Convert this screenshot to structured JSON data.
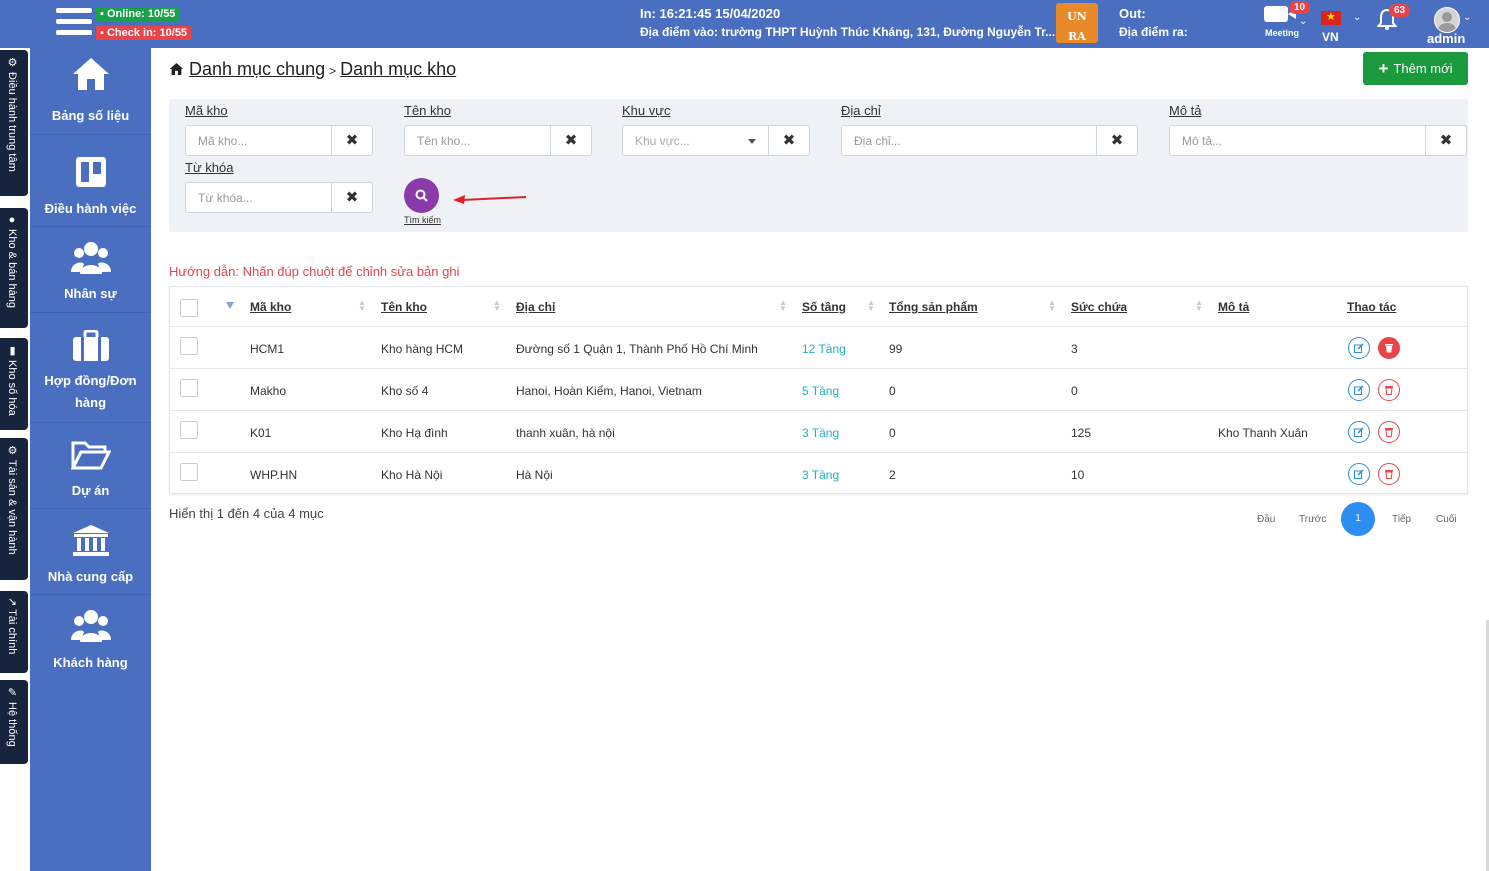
{
  "header": {
    "online_badge": "▪ Online: 10/55",
    "checkin_badge": "▪ Check in: 10/55",
    "in_time": "In: 16:21:45 15/04/2020",
    "in_place": "Địa điểm vào: trường THPT Huỳnh Thúc Kháng, 131, Đường Nguyễn Tr...",
    "logo_text_1": "UN",
    "logo_text_2": "RA",
    "out_label": "Out:",
    "out_place": "Địa điểm ra:",
    "meeting_label": "Meeting",
    "meeting_count": "10",
    "language": "VN",
    "notification_count": "63",
    "user_name": "admin"
  },
  "vertical_tabs": [
    {
      "label": "⚙ Điều hành trung tâm"
    },
    {
      "label": "● Kho & bán hàng"
    },
    {
      "label": "▮ Kho số hóa"
    },
    {
      "label": "⚙ Tài sản & vận hành"
    },
    {
      "label": "↗ Tài chính"
    },
    {
      "label": "✎ Hệ thống"
    }
  ],
  "sidebar": {
    "items": [
      {
        "label": "Bảng số liệu",
        "icon": "home-icon"
      },
      {
        "label": "Điều hành việc",
        "icon": "board-icon"
      },
      {
        "label": "Nhân sự",
        "icon": "users-icon"
      },
      {
        "label": "Hợp đồng/Đơn hàng",
        "icon": "briefcase-icon"
      },
      {
        "label": "Dự án",
        "icon": "folder-icon"
      },
      {
        "label": "Nhà cung cấp",
        "icon": "bank-icon"
      },
      {
        "label": "Khách hàng",
        "icon": "users-icon"
      }
    ]
  },
  "breadcrumb": {
    "parent": "Danh mục chung",
    "separator": ">",
    "current": "Danh mục kho"
  },
  "add_button": "Thêm mới",
  "filters": {
    "ma_kho": {
      "label": "Mã kho",
      "placeholder": "Mã kho..."
    },
    "ten_kho": {
      "label": "Tên kho",
      "placeholder": "Tên kho..."
    },
    "khu_vuc": {
      "label": "Khu vực",
      "placeholder": "Khu vực..."
    },
    "dia_chi": {
      "label": "Địa chỉ",
      "placeholder": "Địa chỉ..."
    },
    "mo_ta": {
      "label": "Mô tả",
      "placeholder": "Mô tả..."
    },
    "tu_khoa": {
      "label": "Từ khóa",
      "placeholder": "Từ khóa..."
    },
    "clear_symbol": "✖",
    "search_label": "Tìm kiếm"
  },
  "hint": "Hướng dẫn: Nhấn đúp chuột để chỉnh sửa bản ghi",
  "table": {
    "columns": [
      "Mã kho",
      "Tên kho",
      "Địa chỉ",
      "Số tầng",
      "Tổng sản phẩm",
      "Sức chứa",
      "Mô tả",
      "Thao tác"
    ],
    "rows": [
      {
        "ma": "HCM1",
        "ten": "Kho hàng HCM",
        "diachi": "Đường số 1 Quận 1, Thành Phố Hồ Chí Minh",
        "tang": "12 Tầng",
        "tong": "99",
        "suc": "3",
        "mota": ""
      },
      {
        "ma": "Makho",
        "ten": "Kho số 4",
        "diachi": "Hanoi, Hoàn Kiếm, Hanoi, Vietnam",
        "tang": "5 Tầng",
        "tong": "0",
        "suc": "0",
        "mota": ""
      },
      {
        "ma": "K01",
        "ten": "Kho Hạ đình",
        "diachi": "thanh xuân, hà nội",
        "tang": "3 Tầng",
        "tong": "0",
        "suc": "125",
        "mota": "Kho Thanh Xuân"
      },
      {
        "ma": "WHP.HN",
        "ten": "Kho Hà Nội",
        "diachi": "Hà Nội",
        "tang": "3 Tầng",
        "tong": "2",
        "suc": "10",
        "mota": ""
      }
    ]
  },
  "footer": {
    "showing": "Hiển thị 1 đến 4 của 4 mục",
    "first": "Đầu",
    "prev": "Trước",
    "current_page": "1",
    "next": "Tiếp",
    "last": "Cuối"
  }
}
